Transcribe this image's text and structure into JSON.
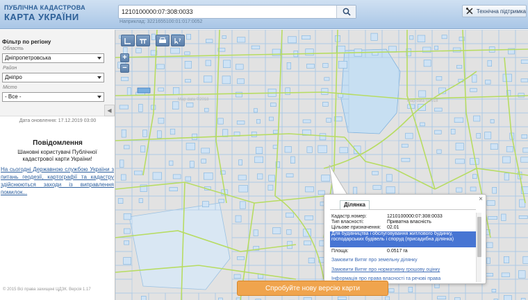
{
  "header": {
    "logo_line1": "ПУБЛІЧНА КАДАСТРОВА",
    "logo_line2": "КАРТА УКРАЇНИ",
    "search_value": "1210100000:07:308:0033",
    "search_hint": "Наприклад: 3221655100:01:017:0052",
    "support_label": "Технічна підтримка"
  },
  "filter": {
    "title": "Фільтр по регіону",
    "oblast_label": "Область",
    "oblast_value": "Дніпропетровська",
    "rayon_label": "Район",
    "rayon_value": "Дніпро",
    "misto_label": "Місто",
    "misto_value": "- Все -",
    "collapse_glyph": "◀"
  },
  "left": {
    "update_date": "Дата оновлення: 17.12.2019 03:00",
    "notice_title": "Повідомлення",
    "notice_text": "Шановні користувачі Публічної кадастрової карти України!",
    "notice_link": "На сьогодні Державною службою України з питань геодезії, картографії та кадастру здійснюються заходи із виправлення помилок...",
    "copyright": "© 2015 Всі права захищені ЦДЗК. Версія 1.17"
  },
  "tools": {
    "zoom_in": "+",
    "zoom_out": "−"
  },
  "watermark": "Map data ©2018",
  "popup": {
    "close": "×",
    "tab": "Ділянка",
    "rows": [
      {
        "label": "Кадастр.номер:",
        "value": "1210100000:07:308:0033"
      },
      {
        "label": "Тип власності:",
        "value": "Приватна власність"
      },
      {
        "label": "Цільове призначення:",
        "value": "02.01"
      },
      {
        "label": "Площа:",
        "value": "0.0517 га"
      }
    ],
    "purpose_text": "Для будівництва і обслуговування житлового будинку, господарських будівель і споруд (присадибна ділянка)",
    "links": [
      "Замовити Витяг про земельну ділянку",
      "Замовити Витяг про нормативну грошову оцінку",
      "Інформація про права власності та речові права"
    ]
  },
  "banner": {
    "label": "Спробуйте нову версію карти"
  },
  "colors": {
    "header_accent": "#2c5f97",
    "road": "#b7dc62",
    "parcel_outline": "#7fb3e0",
    "building_fill": "#cfe3f5",
    "water": "#c7dff2",
    "highlight": "#3d6ed1",
    "banner": "#f0a44d"
  }
}
